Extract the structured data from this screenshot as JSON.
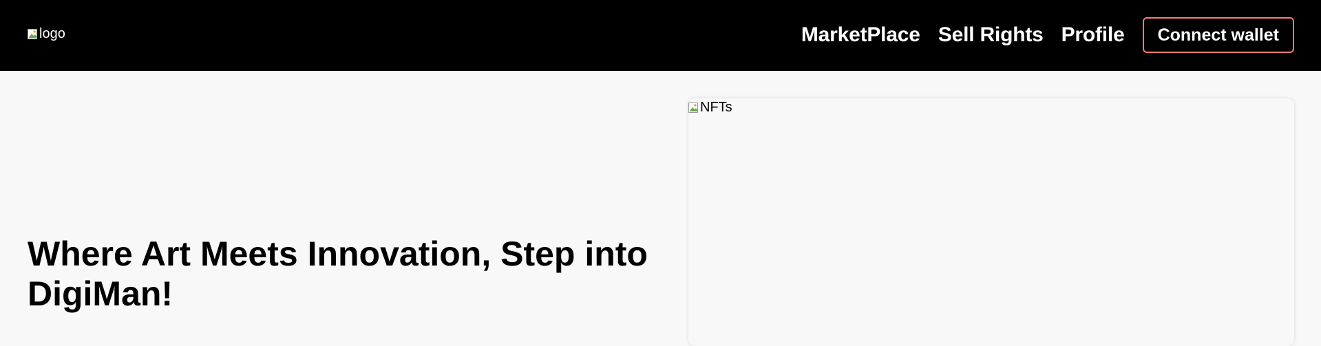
{
  "header": {
    "logo_alt": "logo",
    "nav": [
      {
        "label": "MarketPlace"
      },
      {
        "label": "Sell Rights"
      },
      {
        "label": "Profile"
      }
    ],
    "connect_button": "Connect wallet",
    "accent_color": "#ff7a73"
  },
  "hero": {
    "title": "Where Art Meets Innovation, Step into DigiMan!",
    "image_alt": "NFTs"
  }
}
